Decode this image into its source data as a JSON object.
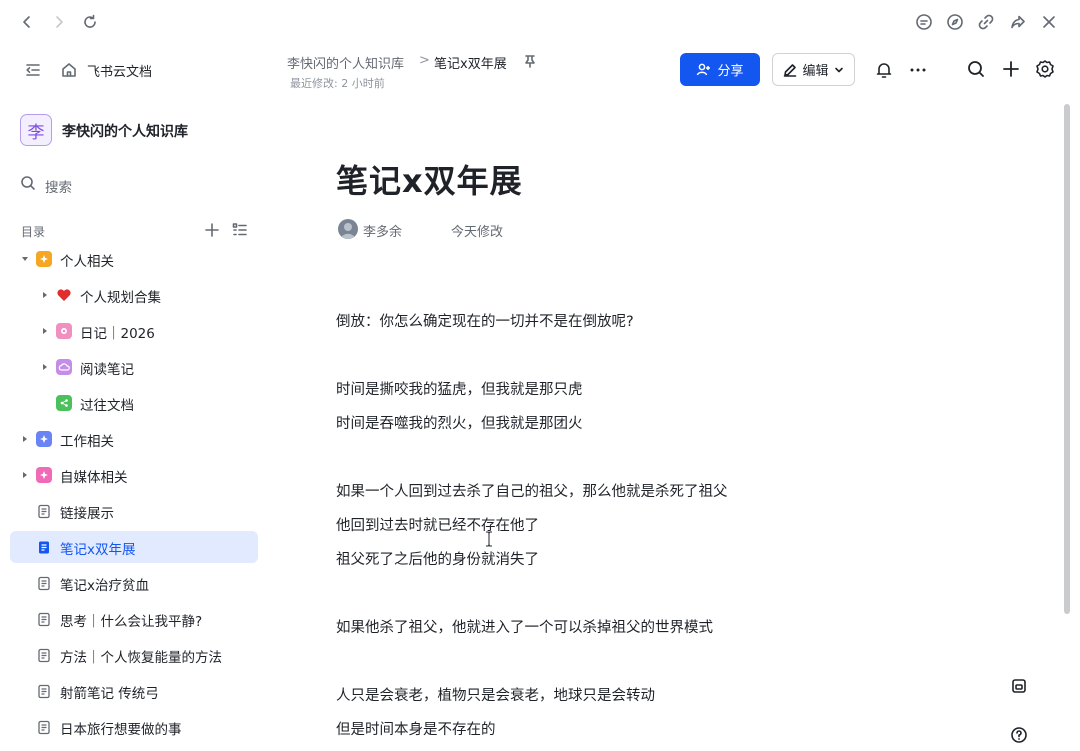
{
  "header": {
    "app_name": "飞书云文档",
    "breadcrumb_parent": "李快闪的个人知识库",
    "breadcrumb_separator": ">",
    "breadcrumb_current": "笔记x双年展",
    "last_modified": "最近修改: 2 小时前",
    "share_label": "分享",
    "edit_label": "编辑"
  },
  "sidebar": {
    "kb_avatar_char": "李",
    "kb_name": "李快闪的个人知识库",
    "search_label": "搜索",
    "toc_label": "目录",
    "items": [
      {
        "label": "个人相关",
        "icon": "star-icon",
        "color": "#f5a623"
      },
      {
        "label": "个人规划合集",
        "icon": "heart-icon",
        "color": "#e02d2d"
      },
      {
        "label": "日记｜2026",
        "icon": "flower-icon",
        "color": "#f08fc0"
      },
      {
        "label": "阅读笔记",
        "icon": "cloud-icon",
        "color": "#c48ee8"
      },
      {
        "label": "过往文档",
        "icon": "folder-share-icon",
        "color": "#4cc05c"
      },
      {
        "label": "工作相关",
        "icon": "star-icon",
        "color": "#6a83f5"
      },
      {
        "label": "自媒体相关",
        "icon": "star-icon",
        "color": "#f06ab8"
      },
      {
        "label": "链接展示",
        "icon": "doc-icon"
      },
      {
        "label": "笔记x双年展",
        "icon": "doc-icon"
      },
      {
        "label": "笔记x治疗贫血",
        "icon": "doc-icon"
      },
      {
        "label": "思考｜什么会让我平静?",
        "icon": "doc-icon"
      },
      {
        "label": "方法｜个人恢复能量的方法",
        "icon": "doc-icon"
      },
      {
        "label": "射箭笔记 传统弓",
        "icon": "doc-icon"
      },
      {
        "label": "日本旅行想要做的事",
        "icon": "doc-icon"
      }
    ]
  },
  "document": {
    "title": "笔记x双年展",
    "author": "李多余",
    "modified": "今天修改",
    "lines": [
      "倒放：你怎么确定现在的一切并不是在倒放呢?",
      "时间是撕咬我的猛虎，但我就是那只虎",
      "时间是吞噬我的烈火，但我就是那团火",
      "如果一个人回到过去杀了自己的祖父，那么他就是杀死了祖父",
      "他回到过去时就已经不存在他了",
      "祖父死了之后他的身份就消失了",
      "如果他杀了祖父，他就进入了一个可以杀掉祖父的世界模式",
      "人只是会衰老，植物只是会衰老，地球只是会转动",
      "但是时间本身是不存在的"
    ]
  },
  "colors": {
    "accent": "#1456f0",
    "active_bg": "#e1eaff",
    "kb_avatar": "#7c4dde"
  }
}
